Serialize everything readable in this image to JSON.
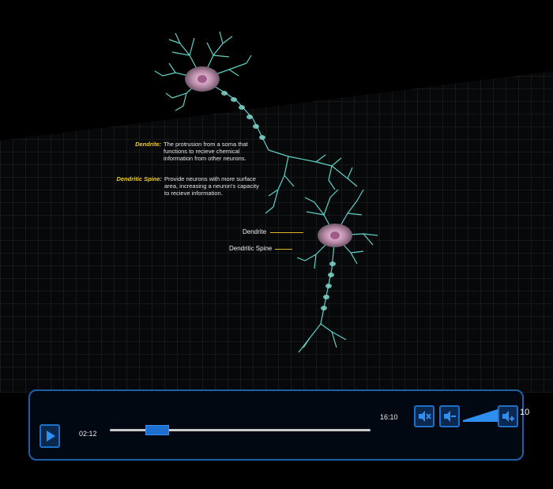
{
  "annotations": {
    "dendrite_term": "Dendrite:",
    "dendrite_text": "The protrusion from a soma that functions to recieve chemical information from other neurons.",
    "spine_term": "Dendritic Spine:",
    "spine_text": "Provide neurons with more surface area, increasing a neuron's capacity to recieve information."
  },
  "callouts": {
    "dendrite": "Dendrite",
    "spine": "Dendritic Spine"
  },
  "player": {
    "current_time": "02:12",
    "total_time": "16:10",
    "progress": 0.136,
    "volume_level": "10",
    "volume_fill": 1.0,
    "colors": {
      "accent": "#1f6fd0",
      "frame": "#1f5fa8",
      "callout": "#e0b62a",
      "term": "#f0cf2a"
    },
    "icons": [
      "play-icon",
      "mute-icon",
      "volume-down-icon",
      "volume-up-icon"
    ]
  }
}
